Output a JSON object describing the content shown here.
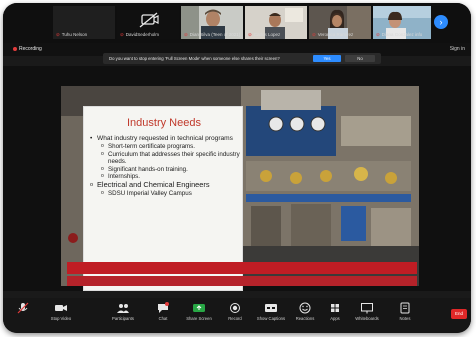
{
  "participants": [
    {
      "name": "Tuhu Nelson",
      "muted": true
    },
    {
      "name": "DavidSederholm",
      "muted": true
    },
    {
      "name": "Dian Silva (Teen of 2021)",
      "muted": true
    },
    {
      "name": "Carlos Lopez",
      "muted": true
    },
    {
      "name": "Veronica Ramirez",
      "muted": true
    },
    {
      "name": "Diana Gonzalez info",
      "muted": true
    }
  ],
  "header": {
    "recording": "Recording",
    "sign_in": "Sign in",
    "prompt": "Do you want to stop entering 'Full Screen Mode' when someone else shares their screen?",
    "yes": "Yes",
    "no": "No"
  },
  "slide": {
    "title": "Industry Needs",
    "bullets": [
      "What industry requested in technical programs"
    ],
    "sub_bullets": [
      "Short-term certificate programs.",
      "Curriculum that addresses their specific industry needs.",
      "Significant hands-on training.",
      "Internships."
    ],
    "section": "Electrical and Chemical Engineers",
    "section_sub": "SDSU Imperial Valley Campus"
  },
  "toolbar": [
    {
      "label": "",
      "icon": "microphone-icon"
    },
    {
      "label": "Stop Video",
      "icon": "video-camera-icon"
    },
    {
      "label": "Participants",
      "icon": "participants-icon",
      "count": "23"
    },
    {
      "label": "Chat",
      "icon": "chat-icon"
    },
    {
      "label": "Share Screen",
      "icon": "share-screen-icon"
    },
    {
      "label": "Record",
      "icon": "record-icon"
    },
    {
      "label": "Show Captions",
      "icon": "captions-icon"
    },
    {
      "label": "Reactions",
      "icon": "reactions-icon"
    },
    {
      "label": "Apps",
      "icon": "apps-icon"
    },
    {
      "label": "Whiteboards",
      "icon": "whiteboard-icon"
    },
    {
      "label": "Notes",
      "icon": "notes-icon"
    }
  ],
  "end_label": "End",
  "colors": {
    "accent": "#2d8cff",
    "danger": "#e02828",
    "slide_title": "#c0392b"
  }
}
